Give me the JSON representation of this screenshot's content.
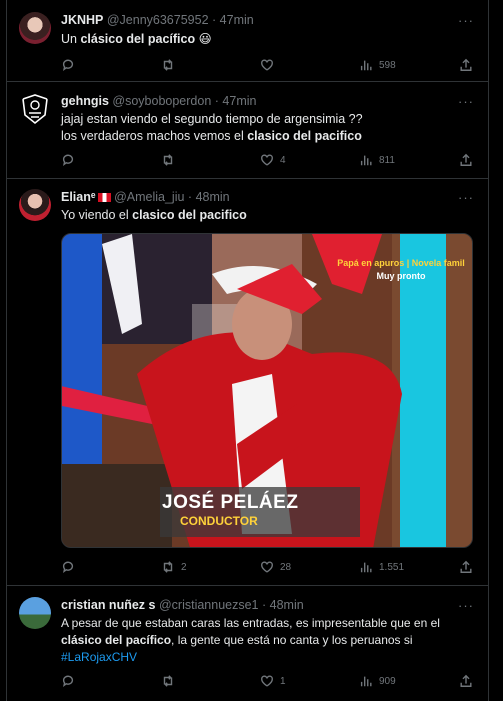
{
  "tweets": [
    {
      "name": "JKNHP",
      "handle": "@Jenny63675952",
      "time": "47min",
      "text_parts": [
        "Un ",
        "clásico",
        " ",
        "del pacífico",
        " 😃"
      ],
      "replies": "",
      "retweets": "",
      "likes": "",
      "views": "598"
    },
    {
      "name": "gehngis",
      "handle": "@soyboboperdon",
      "time": "47min",
      "line1": "jajaj estan viendo el segundo tiempo de argensimia ??",
      "line2_parts": [
        "los verdaderos machos vemos el ",
        "clasico del pacifico"
      ],
      "replies": "",
      "retweets": "",
      "likes": "4",
      "views": "811"
    },
    {
      "name": "Elian",
      "name_sup": "ᵉ",
      "handle": "@Amelia_jiu",
      "time": "48min",
      "text_parts": [
        "Yo viendo el ",
        "clasico del pacifico"
      ],
      "media": {
        "banner_line1": "Papá en apuros | Novela famil",
        "banner_line2": "Muy pronto",
        "caption_name": "JOSÉ PELÁEZ",
        "caption_role": "CONDUCTOR"
      },
      "replies": "",
      "retweets": "2",
      "likes": "28",
      "views": "1.551"
    },
    {
      "name": "cristian nuñez s",
      "handle": "@cristiannuezse1",
      "time": "48min",
      "line1": "A pesar de que estaban caras las entradas, es impresentable que en el",
      "line2_parts": [
        "clásico del pacífico",
        ", la gente que está no canta y los peruanos si"
      ],
      "hashtag": "#LaRojaxCHV",
      "replies": "",
      "retweets": "",
      "likes": "1",
      "views": "909"
    }
  ],
  "colors": {
    "background": "#000000",
    "border": "#2f3336",
    "text": "#e7e9ea",
    "muted": "#71767b",
    "link": "#1d9bf0"
  },
  "icons": [
    "reply-icon",
    "retweet-icon",
    "like-icon",
    "views-icon",
    "share-icon",
    "more-icon"
  ]
}
